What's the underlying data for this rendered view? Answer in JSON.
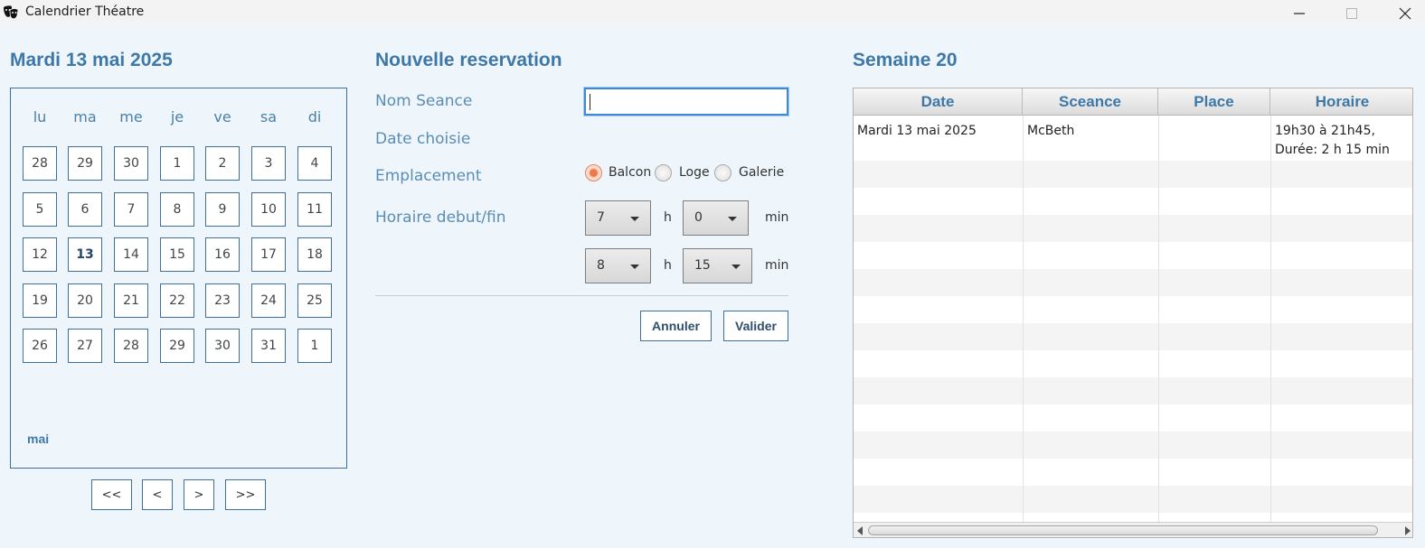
{
  "window": {
    "title": "Calendrier Théatre",
    "icon": "theatre-masks-icon"
  },
  "calendar": {
    "heading": "Mardi 13 mai 2025",
    "weekdays": [
      "lu",
      "ma",
      "me",
      "je",
      "ve",
      "sa",
      "di"
    ],
    "weeks": [
      [
        "28",
        "29",
        "30",
        "1",
        "2",
        "3",
        "4"
      ],
      [
        "5",
        "6",
        "7",
        "8",
        "9",
        "10",
        "11"
      ],
      [
        "12",
        "13",
        "14",
        "15",
        "16",
        "17",
        "18"
      ],
      [
        "19",
        "20",
        "21",
        "22",
        "23",
        "24",
        "25"
      ],
      [
        "26",
        "27",
        "28",
        "29",
        "30",
        "31",
        "1"
      ]
    ],
    "selected_day": "13",
    "month_label": "mai",
    "nav": [
      "<<",
      "<",
      ">",
      ">>"
    ]
  },
  "form": {
    "heading": "Nouvelle reservation",
    "nom_label": "Nom Seance",
    "nom_value": "",
    "date_label": "Date choisie",
    "emplacement_label": "Emplacement",
    "emplacement_options": [
      "Balcon",
      "Loge",
      "Galerie"
    ],
    "emplacement_selected": "Balcon",
    "horaire_label": "Horaire debut/fin",
    "start_hour": "7",
    "start_min": "0",
    "end_hour": "8",
    "end_min": "15",
    "hour_unit": "h",
    "min_unit": "min",
    "cancel_label": "Annuler",
    "validate_label": "Valider"
  },
  "week": {
    "heading": "Semaine 20",
    "columns": [
      "Date",
      "Sceance",
      "Place",
      "Horaire"
    ],
    "rows": [
      {
        "date": "Mardi 13 mai 2025",
        "seance": "McBeth",
        "place": "",
        "horaire_1": "19h30 à 21h45,",
        "horaire_2": "Durée: 2 h 15 min"
      }
    ]
  },
  "colors": {
    "accent": "#3d78a8",
    "border": "#3d6f9a",
    "background": "#eef6fc",
    "radio_selected": "#f0784c"
  }
}
